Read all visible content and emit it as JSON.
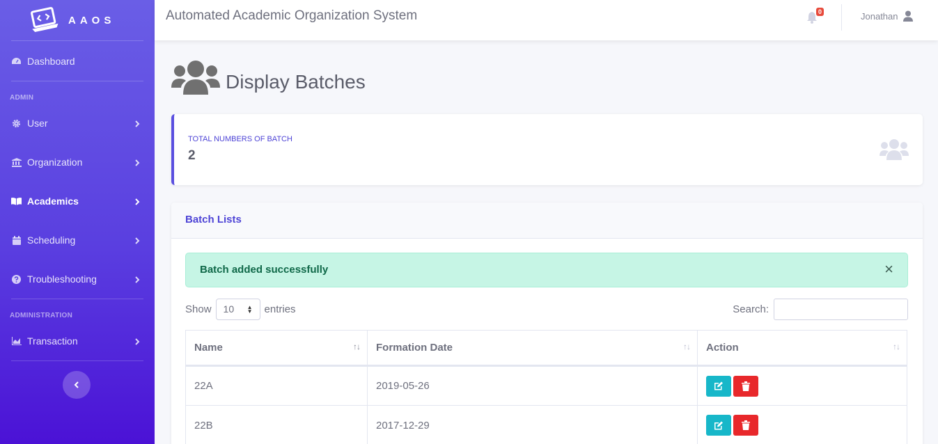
{
  "brand": {
    "name": "AAOS"
  },
  "sidebar": {
    "dashboard": "Dashboard",
    "admin_heading": "ADMIN",
    "items": [
      {
        "label": "User",
        "icon": "gear-icon"
      },
      {
        "label": "Organization",
        "icon": "bank-icon"
      },
      {
        "label": "Academics",
        "icon": "book-icon",
        "active": true
      },
      {
        "label": "Scheduling",
        "icon": "calendar-icon"
      },
      {
        "label": "Troubleshooting",
        "icon": "question-circle-icon"
      }
    ],
    "administration_heading": "ADMINISTRATION",
    "transaction": "Transaction"
  },
  "topbar": {
    "title": "Automated Academic Organization System",
    "notification_count": "0",
    "user_name": "Jonathan"
  },
  "page": {
    "title": "Display Batches"
  },
  "stat": {
    "label": "TOTAL NUMBERS OF BATCH",
    "value": "2"
  },
  "batch_list": {
    "title": "Batch Lists",
    "alert": "Batch added successfully",
    "show_label": "Show",
    "entries_value": "10",
    "entries_label": "entries",
    "search_label": "Search:",
    "columns": [
      "Name",
      "Formation Date",
      "Action"
    ],
    "rows": [
      {
        "name": "22A",
        "date": "2019-05-26"
      },
      {
        "name": "22B",
        "date": "2017-12-29"
      }
    ]
  },
  "colors": {
    "accent": "#4e44d6",
    "edit": "#17b7c9",
    "delete": "#e8282b",
    "alert_bg": "#c6f5e5"
  }
}
